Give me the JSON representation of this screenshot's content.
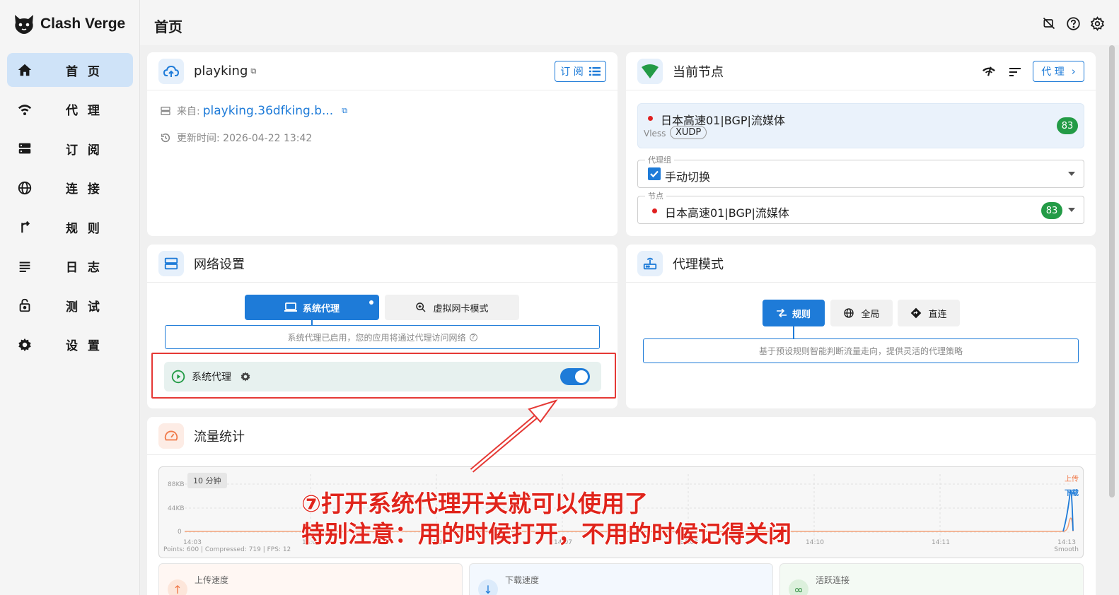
{
  "app": {
    "name": "Clash Verge"
  },
  "page_title": "首页",
  "sidebar": {
    "items": [
      {
        "label": "首 页",
        "icon": "home-icon",
        "active": true
      },
      {
        "label": "代 理",
        "icon": "wifi-icon"
      },
      {
        "label": "订 阅",
        "icon": "storage-icon"
      },
      {
        "label": "连 接",
        "icon": "globe-icon"
      },
      {
        "label": "规 则",
        "icon": "fork-icon"
      },
      {
        "label": "日 志",
        "icon": "list-icon"
      },
      {
        "label": "测 试",
        "icon": "lock-icon"
      },
      {
        "label": "设 置",
        "icon": "gear-icon"
      }
    ]
  },
  "top_icons": [
    "unlink-icon",
    "help-icon",
    "settings-icon"
  ],
  "profile": {
    "name": "playking",
    "subscribe_label": "订 阅",
    "source_label": "来自:",
    "source_url": "playking.36dfking.b...",
    "updated_label": "更新时间: 2026-04-22 13:42"
  },
  "current_node": {
    "title": "当前节点",
    "proxy_button": "代 理",
    "node_name": "日本高速01|BGP|流媒体",
    "protocol": "Vless",
    "chip": "XUDP",
    "latency": "83",
    "group_label": "代理组",
    "group_value": "手动切换",
    "node_label": "节点",
    "node_value": "日本高速01|BGP|流媒体",
    "node_latency": "83"
  },
  "network": {
    "title": "网络设置",
    "tab_system": "系统代理",
    "tab_tun": "虚拟网卡模式",
    "description": "系统代理已启用，您的应用将通过代理访问网络",
    "toggle_label": "系统代理",
    "toggle_on": true
  },
  "proxy_mode": {
    "title": "代理模式",
    "modes": [
      "规则",
      "全局",
      "直连"
    ],
    "active": "规则",
    "description": "基于预设规则智能判断流量走向，提供灵活的代理策略"
  },
  "traffic": {
    "title": "流量统计",
    "range": "10 分钟",
    "legend_up": "上传",
    "legend_down": "下载",
    "y_labels": [
      "88KB",
      "44KB",
      "0"
    ],
    "x_labels": [
      "14:03",
      "14:04",
      "14:06",
      "14:07",
      "14:09",
      "14:10",
      "14:11",
      "14:13"
    ],
    "footer_left": "Points: 600 | Compressed: 719 | FPS: 12",
    "footer_right": "Smooth",
    "stats": [
      {
        "label": "上传速度",
        "color": "#f4a27a"
      },
      {
        "label": "下载速度",
        "color": "#6aa8e8"
      },
      {
        "label": "活跃连接",
        "color": "#4caf50"
      }
    ]
  },
  "annotation": {
    "line1": "⑦打开系统代理开关就可以使用了",
    "line2": "特别注意：用的时候打开，不用的时候记得关闭"
  },
  "colors": {
    "accent": "#1e7bd8",
    "green": "#239b46",
    "annotation": "#e0241b"
  }
}
